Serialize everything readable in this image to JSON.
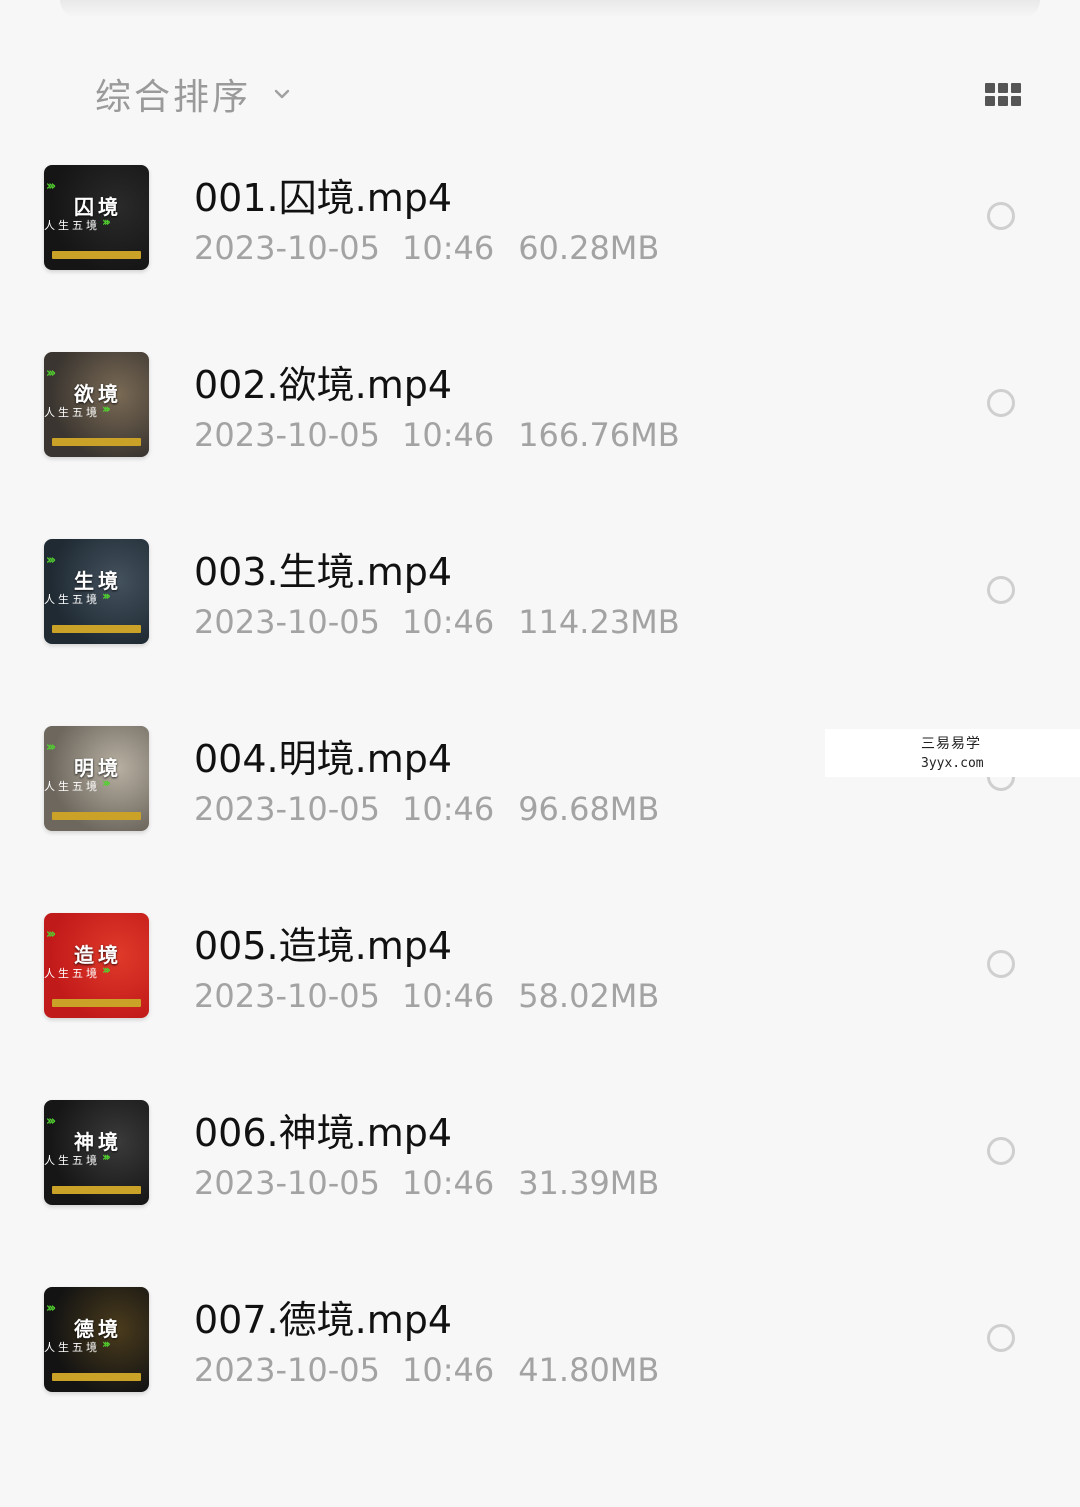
{
  "sort": {
    "label": "综合排序",
    "icon": "chevron-down-icon"
  },
  "view_toggle": {
    "icon": "grid-view-icon"
  },
  "files": [
    {
      "name": "001.囚境.mp4",
      "date": "2023-10-05",
      "time": "10:46",
      "size": "60.28MB",
      "thumb": {
        "title": "囚境",
        "subtitle": "人生五境",
        "bg": "#151515",
        "accent": "#2a2a2a"
      }
    },
    {
      "name": "002.欲境.mp4",
      "date": "2023-10-05",
      "time": "10:46",
      "size": "166.76MB",
      "thumb": {
        "title": "欲境",
        "subtitle": "人生五境",
        "bg": "#3a3530",
        "accent": "#7a6a55"
      }
    },
    {
      "name": "003.生境.mp4",
      "date": "2023-10-05",
      "time": "10:46",
      "size": "114.23MB",
      "thumb": {
        "title": "生境",
        "subtitle": "人生五境",
        "bg": "#1f2a33",
        "accent": "#44525e"
      }
    },
    {
      "name": "004.明境.mp4",
      "date": "2023-10-05",
      "time": "10:46",
      "size": "96.68MB",
      "thumb": {
        "title": "明境",
        "subtitle": "人生五境",
        "bg": "#6d675e",
        "accent": "#b8b0a2"
      }
    },
    {
      "name": "005.造境.mp4",
      "date": "2023-10-05",
      "time": "10:46",
      "size": "58.02MB",
      "thumb": {
        "title": "造境",
        "subtitle": "人生五境",
        "bg": "#c11a1a",
        "accent": "#e03a2a"
      }
    },
    {
      "name": "006.神境.mp4",
      "date": "2023-10-05",
      "time": "10:46",
      "size": "31.39MB",
      "thumb": {
        "title": "神境",
        "subtitle": "人生五境",
        "bg": "#161616",
        "accent": "#3a3a3a"
      }
    },
    {
      "name": "007.德境.mp4",
      "date": "2023-10-05",
      "time": "10:46",
      "size": "41.80MB",
      "thumb": {
        "title": "德境",
        "subtitle": "人生五境",
        "bg": "#131313",
        "accent": "#4a3b1c"
      }
    }
  ],
  "watermark": {
    "line1": "三易易学",
    "line2": "3yyx.com"
  }
}
